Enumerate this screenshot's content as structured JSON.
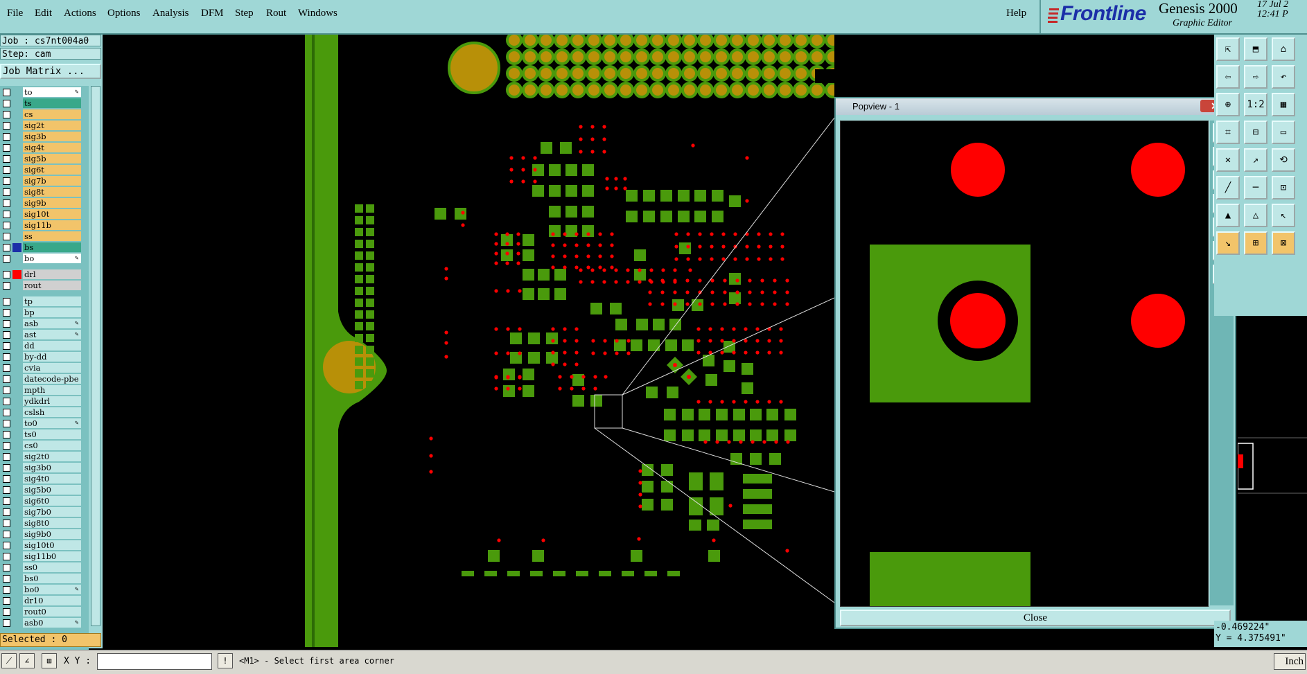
{
  "menu": {
    "items": [
      "File",
      "Edit",
      "Actions",
      "Options",
      "Analysis",
      "DFM",
      "Step",
      "Rout",
      "Windows"
    ],
    "help": "Help"
  },
  "branding": {
    "logo": "Frontline",
    "product": "Genesis 2000",
    "subtitle": "Graphic Editor",
    "date": "17 Jul 2",
    "time": "12:41 P"
  },
  "left_panel": {
    "job": "Job : cs7nt004a0",
    "step": "Step: cam",
    "job_matrix": "Job Matrix ...",
    "selected": "Selected : 0"
  },
  "layers": {
    "board": [
      {
        "name": "to",
        "bg": "#ffffff",
        "flag": "✎"
      },
      {
        "name": "ts",
        "bg": "#39a88a"
      },
      {
        "name": "cs",
        "bg": "#f2c46a"
      },
      {
        "name": "sig2t",
        "bg": "#f2c46a"
      },
      {
        "name": "sig3b",
        "bg": "#f2c46a"
      },
      {
        "name": "sig4t",
        "bg": "#f2c46a"
      },
      {
        "name": "sig5b",
        "bg": "#f2c46a"
      },
      {
        "name": "sig6t",
        "bg": "#f2c46a"
      },
      {
        "name": "sig7b",
        "bg": "#f2c46a"
      },
      {
        "name": "sig8t",
        "bg": "#f2c46a"
      },
      {
        "name": "sig9b",
        "bg": "#f2c46a"
      },
      {
        "name": "sig10t",
        "bg": "#f2c46a"
      },
      {
        "name": "sig11b",
        "bg": "#f2c46a"
      },
      {
        "name": "ss",
        "bg": "#f2c46a"
      },
      {
        "name": "bs",
        "bg": "#39a88a",
        "marker": "#1b2ea8"
      },
      {
        "name": "bo",
        "bg": "#ffffff",
        "flag": "✎"
      }
    ],
    "drill": [
      {
        "name": "drl",
        "bg": "#d0d0d0",
        "marker": "#ff0000"
      },
      {
        "name": "rout",
        "bg": "#d0d0d0"
      }
    ],
    "misc": [
      {
        "name": "tp",
        "bg": "#bfe7e6"
      },
      {
        "name": "bp",
        "bg": "#bfe7e6"
      },
      {
        "name": "asb",
        "bg": "#bfe7e6",
        "flag": "✎"
      },
      {
        "name": "ast",
        "bg": "#bfe7e6",
        "flag": "✎"
      },
      {
        "name": "dd",
        "bg": "#bfe7e6"
      },
      {
        "name": "by-dd",
        "bg": "#bfe7e6"
      },
      {
        "name": "cvia",
        "bg": "#bfe7e6"
      },
      {
        "name": "datecode-pbe",
        "bg": "#bfe7e6"
      },
      {
        "name": "mpth",
        "bg": "#bfe7e6"
      },
      {
        "name": "ydkdrl",
        "bg": "#bfe7e6"
      },
      {
        "name": "cslsh",
        "bg": "#bfe7e6"
      },
      {
        "name": "to0",
        "bg": "#bfe7e6",
        "flag": "✎"
      },
      {
        "name": "ts0",
        "bg": "#bfe7e6"
      },
      {
        "name": "cs0",
        "bg": "#bfe7e6"
      },
      {
        "name": "sig2t0",
        "bg": "#bfe7e6"
      },
      {
        "name": "sig3b0",
        "bg": "#bfe7e6"
      },
      {
        "name": "sig4t0",
        "bg": "#bfe7e6"
      },
      {
        "name": "sig5b0",
        "bg": "#bfe7e6"
      },
      {
        "name": "sig6t0",
        "bg": "#bfe7e6"
      },
      {
        "name": "sig7b0",
        "bg": "#bfe7e6"
      },
      {
        "name": "sig8t0",
        "bg": "#bfe7e6"
      },
      {
        "name": "sig9b0",
        "bg": "#bfe7e6"
      },
      {
        "name": "sig10t0",
        "bg": "#bfe7e6"
      },
      {
        "name": "sig11b0",
        "bg": "#bfe7e6"
      },
      {
        "name": "ss0",
        "bg": "#bfe7e6"
      },
      {
        "name": "bs0",
        "bg": "#bfe7e6"
      },
      {
        "name": "bo0",
        "bg": "#bfe7e6",
        "flag": "✎"
      },
      {
        "name": "dr10",
        "bg": "#bfe7e6"
      },
      {
        "name": "rout0",
        "bg": "#bfe7e6"
      },
      {
        "name": "asb0",
        "bg": "#bfe7e6",
        "flag": "✎"
      }
    ]
  },
  "popview": {
    "title": "Popview - 1",
    "close_x": "✕",
    "close_button": "Close"
  },
  "status": {
    "xy_label": "X Y :",
    "xy_value": "",
    "hint": "<M1> - Select first area corner",
    "unit": "Inch",
    "x_coord": "-0.469224\"",
    "y_coord": "Y = 4.375491\""
  },
  "colors": {
    "pad_green": "#4a9a0c",
    "pad_gold": "#b89008",
    "drill_red": "#ff0000",
    "ui_teal": "#9fd7d6"
  },
  "icons": {
    "tools": [
      "zoom-in-icon",
      "zoom-out-icon",
      "fit-icon",
      "home-icon",
      "pan-left-icon",
      "pan-right-icon",
      "back-icon",
      "page-icon",
      "move-icon",
      "scale-icon",
      "grid-icon",
      "snap-icon",
      "measure-icon",
      "ruler-icon",
      "cross-icon",
      "line-icon",
      "arc-icon",
      "slash-icon",
      "minus-icon",
      "connect-icon",
      "triangle-icon",
      "triangle-fill-icon",
      "pointer-icon",
      "pointer-select-icon"
    ]
  }
}
